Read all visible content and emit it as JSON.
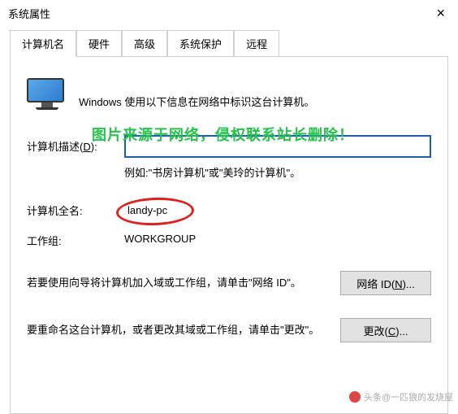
{
  "window": {
    "title": "系统属性",
    "close_glyph": "×"
  },
  "watermark_top": "图片来源于网络，侵权联系站长删除！",
  "tabs": {
    "t0": "计算机名",
    "t1": "硬件",
    "t2": "高级",
    "t3": "系统保护",
    "t4": "远程"
  },
  "intro": "Windows 使用以下信息在网络中标识这台计算机。",
  "desc": {
    "label_prefix": "计算机描述(",
    "label_key": "D",
    "label_suffix": "):",
    "value": "",
    "example": "例如:\"书房计算机\"或\"美玲的计算机\"。"
  },
  "fullname": {
    "label": "计算机全名:",
    "value": "landy-pc"
  },
  "workgroup": {
    "label": "工作组:",
    "value": "WORKGROUP"
  },
  "netid": {
    "text": "若要使用向导将计算机加入域或工作组，请单击\"网络 ID\"。",
    "button_prefix": "网络 ID(",
    "button_key": "N",
    "button_suffix": ")..."
  },
  "change": {
    "text": "要重命名这台计算机，或者更改其域或工作组，请单击\"更改\"。",
    "button_prefix": "更改(",
    "button_key": "C",
    "button_suffix": ")..."
  },
  "footer_watermark": "头条@一匹狼的发烧屋"
}
